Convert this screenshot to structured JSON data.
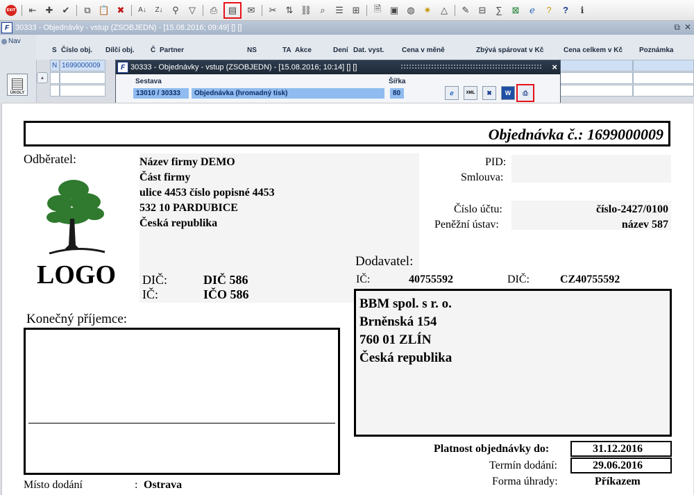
{
  "toolbar": {
    "exit_label": "EXIT",
    "icons": [
      "exit-icon",
      "first-record-icon",
      "add-icon",
      "mark-icon",
      "copy-icon",
      "paste-icon",
      "delete-icon",
      "sort-asc-icon",
      "sort-desc-icon",
      "filter-key-icon",
      "filter-icon",
      "print-icon",
      "print-preview-icon",
      "email-icon",
      "cut-icon",
      "move-icon",
      "link-icon",
      "search-icon",
      "list-icon",
      "tree-icon",
      "document-icon",
      "save-icon",
      "globe-icon",
      "settings-icon",
      "chart-icon",
      "edit-icon",
      "calculator-icon",
      "sum-icon",
      "excel-icon",
      "internet-explorer-icon",
      "help-key-icon",
      "help-icon",
      "info-icon"
    ]
  },
  "window": {
    "title": "30333 - Objednávky - vstup (ZSOBJEDN) - [15.08.2016; 09:49] [] []"
  },
  "nav": {
    "nav_label": "Nav",
    "ukoly_label": "ÚKOLY"
  },
  "grid": {
    "columns": [
      "S",
      "Číslo obj.",
      "Dílčí obj.",
      "Č",
      "Partner",
      "NS",
      "TA",
      "Akce",
      "Dení",
      "Dat. vyst.",
      "Cena v měně",
      "Zbývá spárovat v Kč",
      "Cena celkem v Kč",
      "Poznámka"
    ],
    "row1": {
      "status": "N",
      "order_number": "1699000009"
    }
  },
  "popup": {
    "title": "30333 - Objednávky - vstup (ZSOBJEDN) - [15.08.2016; 10:14] [] []",
    "close": "×",
    "sestava_label": "Sestava",
    "sirka_label": "Šířka",
    "sestava_code": "13010 / 30333",
    "sestava_name": "Objednávka  (hromadný tisk)",
    "sirka_value": "80",
    "xml_label": "XML",
    "word_label": "W"
  },
  "doc": {
    "title": "Objednávka č.: 1699000009",
    "odberatel_label": "Odběratel:",
    "logo_text": "LOGO",
    "customer": {
      "name": "Název firmy DEMO",
      "part": "Část firmy",
      "street": "ulice 4453 číslo popisné 4453",
      "city": "532 10 PARDUBICE",
      "country": "Česká republika"
    },
    "customer_dic_label": "DIČ:",
    "customer_dic": "DIČ 586",
    "customer_ic_label": "IČ:",
    "customer_ic": "IČO 586",
    "pid_label": "PID:",
    "smlouva_label": "Smlouva:",
    "account_label": "Číslo účtu:",
    "account_value": "číslo-2427/0100",
    "bank_label": "Peněžní ústav:",
    "bank_value": "název 587",
    "dodavatel_label": "Dodavatel:",
    "supplier_ic_label": "IČ:",
    "supplier_ic": "40755592",
    "supplier_dic_label": "DIČ:",
    "supplier_dic": "CZ40755592",
    "supplier": {
      "name": "BBM spol. s r. o.",
      "street": "Brněnská 154",
      "city": "760 01 ZLÍN",
      "country": "Česká republika"
    },
    "konecny_label": "Konečný příjemce:",
    "platnost_label": "Platnost objednávky do:",
    "platnost_value": "31.12.2016",
    "termin_label": "Termín dodání:",
    "termin_value": "29.06.2016",
    "forma_label": "Forma úhrady:",
    "forma_value": "Příkazem",
    "misto_label": "Místo dodání",
    "misto_sep": ":",
    "misto_value": "Ostrava"
  }
}
